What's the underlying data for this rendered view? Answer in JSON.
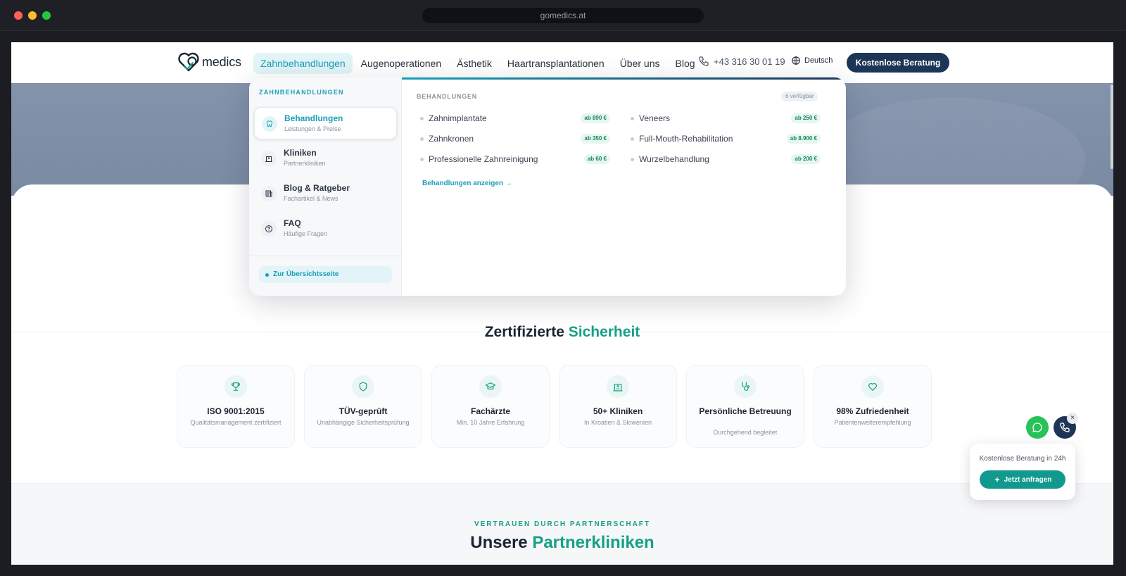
{
  "browser": {
    "url": "gomedics.at"
  },
  "header": {
    "logo_text": "medics",
    "nav": [
      {
        "label": "Zahnbehandlungen",
        "active": true
      },
      {
        "label": "Augenoperationen"
      },
      {
        "label": "Ästhetik"
      },
      {
        "label": "Haartransplantationen"
      },
      {
        "label": "Über uns"
      },
      {
        "label": "Blog"
      }
    ],
    "phone": "+43 316 30 01 19",
    "language": "Deutsch",
    "cta": "Kostenlose Beratung"
  },
  "mega_menu": {
    "eyebrow": "ZAHNBEHANDLUNGEN",
    "items": [
      {
        "title": "Behandlungen",
        "subtitle": "Leistungen & Preise",
        "icon": "tooth-icon"
      },
      {
        "title": "Kliniken",
        "subtitle": "Partnerkliniken",
        "icon": "hospital-icon"
      },
      {
        "title": "Blog & Ratgeber",
        "subtitle": "Fachartikel & News",
        "icon": "newspaper-icon"
      },
      {
        "title": "FAQ",
        "subtitle": "Häufige Fragen",
        "icon": "question-icon"
      }
    ],
    "overview_link": "Zur Übersichtsseite",
    "right_title": "BEHANDLUNGEN",
    "available_badge": "6 verfügbar",
    "treatments": [
      {
        "name": "Zahnimplantate",
        "price": "ab 890 €"
      },
      {
        "name": "Zahnkronen",
        "price": "ab 350 €"
      },
      {
        "name": "Professionelle Zahnreinigung",
        "price": "ab 60 €"
      },
      {
        "name": "Veneers",
        "price": "ab 250 €"
      },
      {
        "name": "Full-Mouth-Rehabilitation",
        "price": "ab 8.900 €"
      },
      {
        "name": "Wurzelbehandlung",
        "price": "ab 200 €"
      }
    ],
    "show_link": "Behandlungen anzeigen →"
  },
  "certified": {
    "title_main": "Zertifizierte ",
    "title_accent": "Sicherheit",
    "cards": [
      {
        "title": "ISO 9001:2015",
        "subtitle": "Qualitätsmanagement zertifiziert",
        "icon": "trophy-icon"
      },
      {
        "title": "TÜV-geprüft",
        "subtitle": "Unabhängige Sicherheitsprüfung",
        "icon": "shield-icon"
      },
      {
        "title": "Fachärzte",
        "subtitle": "Min. 10 Jahre Erfahrung",
        "icon": "graduation-cap-icon"
      },
      {
        "title": "50+ Kliniken",
        "subtitle": "In Kroatien & Slowenien",
        "icon": "hospital-icon"
      },
      {
        "title": "Persönliche Betreuung",
        "subtitle": "Durchgehend begleitet",
        "icon": "stethoscope-icon"
      },
      {
        "title": "98% Zufriedenheit",
        "subtitle": "Patientenweiterempfehlung",
        "icon": "heart-icon"
      }
    ]
  },
  "partners": {
    "eyebrow": "VERTRAUEN DURCH PARTNERSCHAFT",
    "title_main": "Unsere ",
    "title_accent": "Partnerkliniken"
  },
  "widget": {
    "close": "×",
    "text": "Kostenlose Beratung in 24h",
    "button": "Jetzt anfragen"
  },
  "colors": {
    "brand_navy": "#1d3557",
    "accent_cyan": "#1a9fb8",
    "accent_green": "#16a085",
    "whatsapp": "#25c35a"
  }
}
